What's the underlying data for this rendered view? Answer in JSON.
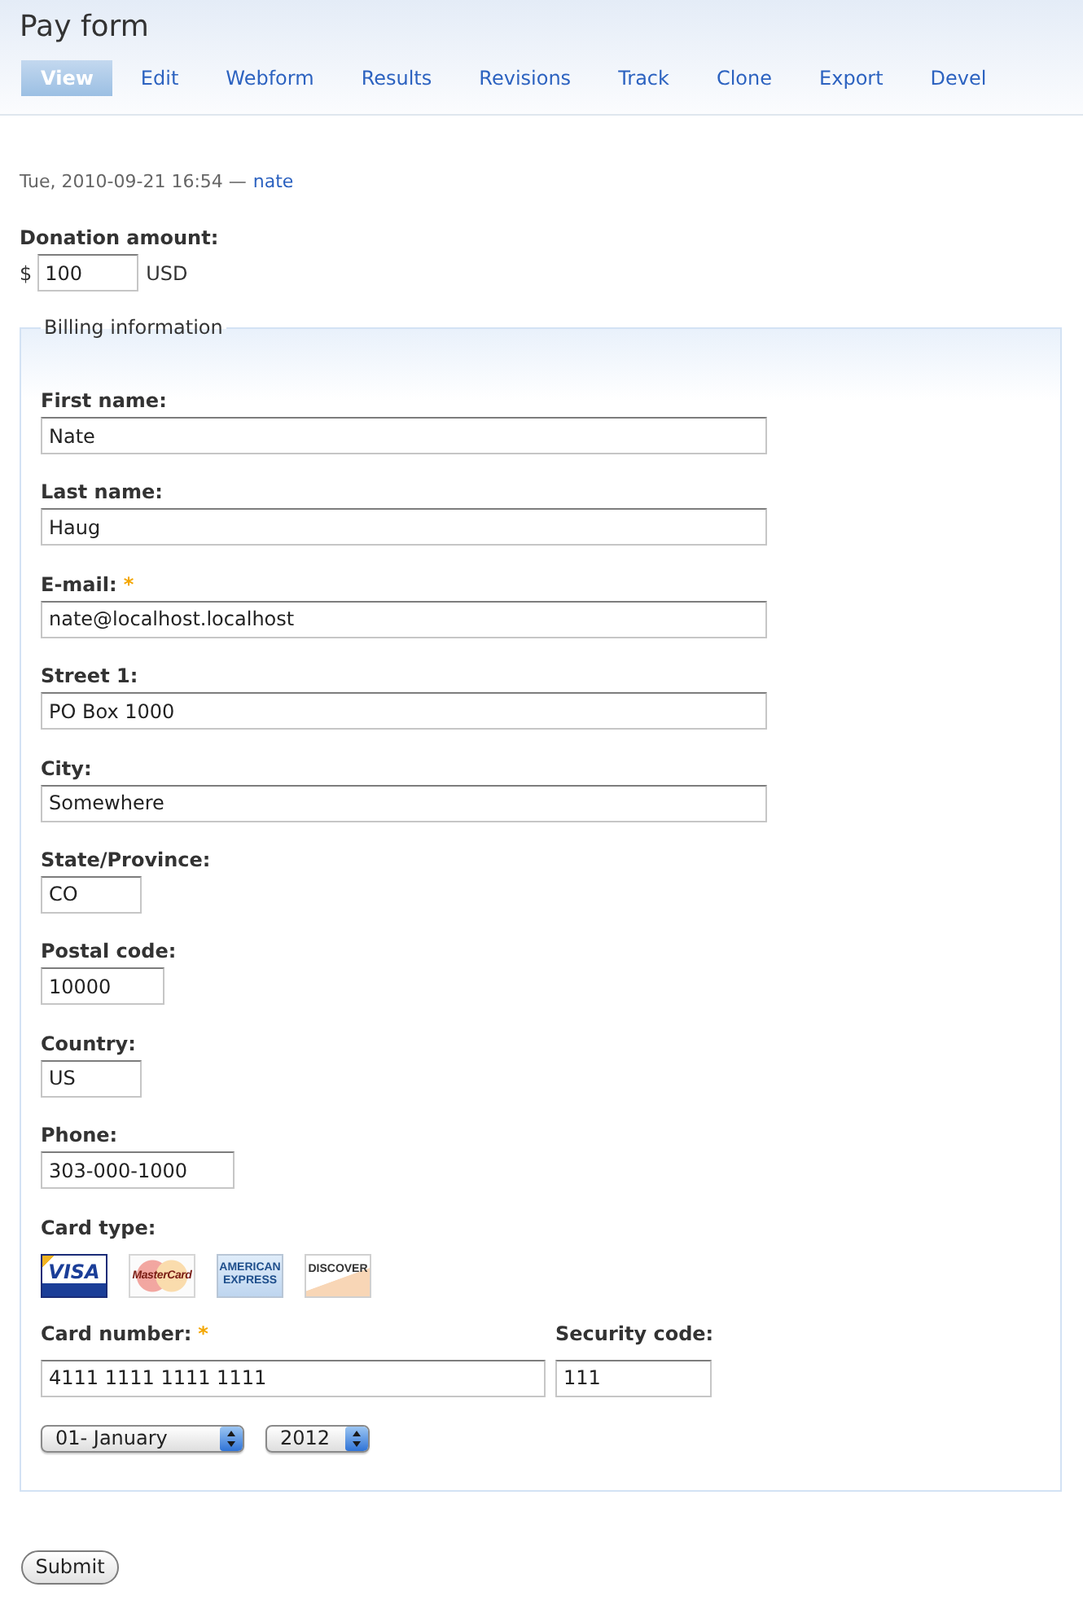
{
  "page": {
    "title": "Pay form"
  },
  "tabs": [
    {
      "label": "View",
      "selected": true
    },
    {
      "label": "Edit",
      "selected": false
    },
    {
      "label": "Webform",
      "selected": false
    },
    {
      "label": "Results",
      "selected": false
    },
    {
      "label": "Revisions",
      "selected": false
    },
    {
      "label": "Track",
      "selected": false
    },
    {
      "label": "Clone",
      "selected": false
    },
    {
      "label": "Export",
      "selected": false
    },
    {
      "label": "Devel",
      "selected": false
    }
  ],
  "submitted": {
    "date": "Tue, 2010-09-21 16:54 —",
    "author": "nate"
  },
  "donation": {
    "label": "Donation amount:",
    "prefix": "$",
    "value": "100",
    "suffix": "USD"
  },
  "billing": {
    "legend": "Billing information",
    "fields": [
      {
        "kind": "wide",
        "label": "First name:",
        "value": "Nate"
      },
      {
        "kind": "wide",
        "label": "Last name:",
        "value": "Haug"
      },
      {
        "kind": "wide",
        "label": "E-mail:",
        "required_mark": "*",
        "value": "nate@localhost.localhost"
      },
      {
        "kind": "wide",
        "label": "Street 1:",
        "value": "PO Box 1000"
      },
      {
        "kind": "wide",
        "label": "City:",
        "value": "Somewhere"
      },
      {
        "kind": "tiny",
        "label": "State/Province:",
        "value": "CO"
      },
      {
        "kind": "small",
        "label": "Postal code:",
        "value": "10000"
      },
      {
        "kind": "tiny",
        "label": "Country:",
        "value": "US"
      },
      {
        "kind": "medium",
        "label": "Phone:",
        "value": "303-000-1000"
      }
    ],
    "card_type": {
      "label": "Card type:",
      "options": [
        {
          "kind": "visa",
          "label": "VISA",
          "selected": true
        },
        {
          "kind": "mastercard",
          "label": "MasterCard",
          "selected": false
        },
        {
          "kind": "amex",
          "label": "AMERICAN EXPRESS",
          "selected": false
        },
        {
          "kind": "discover",
          "label": "DISCOVER",
          "selected": false
        }
      ]
    },
    "card_number": {
      "label": "Card number:",
      "required_mark": "*",
      "value": "4111 1111 1111 1111"
    },
    "security_code": {
      "label": "Security code:",
      "value": "111"
    },
    "expiration": {
      "month": "01- January",
      "year": "2012"
    }
  },
  "submit": "Submit"
}
